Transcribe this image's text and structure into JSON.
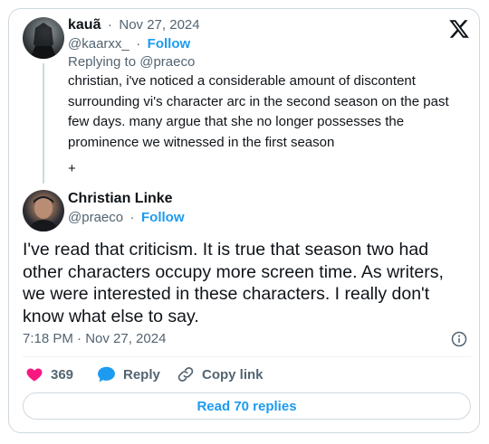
{
  "quoted_post": {
    "author_name": "kauã",
    "date": "Nov 27, 2024",
    "handle": "@kaarxx_",
    "follow_label": "Follow",
    "replying_to": "Replying to @praeco",
    "text": "christian, i've noticed a considerable amount of discontent surrounding vi's character arc in the second season on the past few days. many argue that she no longer possesses the prominence we witnessed in the first season",
    "extra": "+"
  },
  "main_post": {
    "author_name": "Christian Linke",
    "handle": "@praeco",
    "follow_label": "Follow",
    "text": "I've read that criticism. It is true that season two had other characters occupy more screen time. As writers, we were interested in these characters. I really don't know what else to say.",
    "timestamp": "7:18 PM · Nov 27, 2024"
  },
  "actions": {
    "likes": "369",
    "reply_label": "Reply",
    "copy_link_label": "Copy link"
  },
  "read_replies_label": "Read 70 replies",
  "separator": "·",
  "colors": {
    "accent": "#1d9bf0",
    "like": "#f91880",
    "muted": "#536471",
    "border": "#cfd9de"
  },
  "icons": [
    "x-logo-icon",
    "info-icon",
    "heart-icon",
    "reply-bubble-icon",
    "link-icon"
  ]
}
